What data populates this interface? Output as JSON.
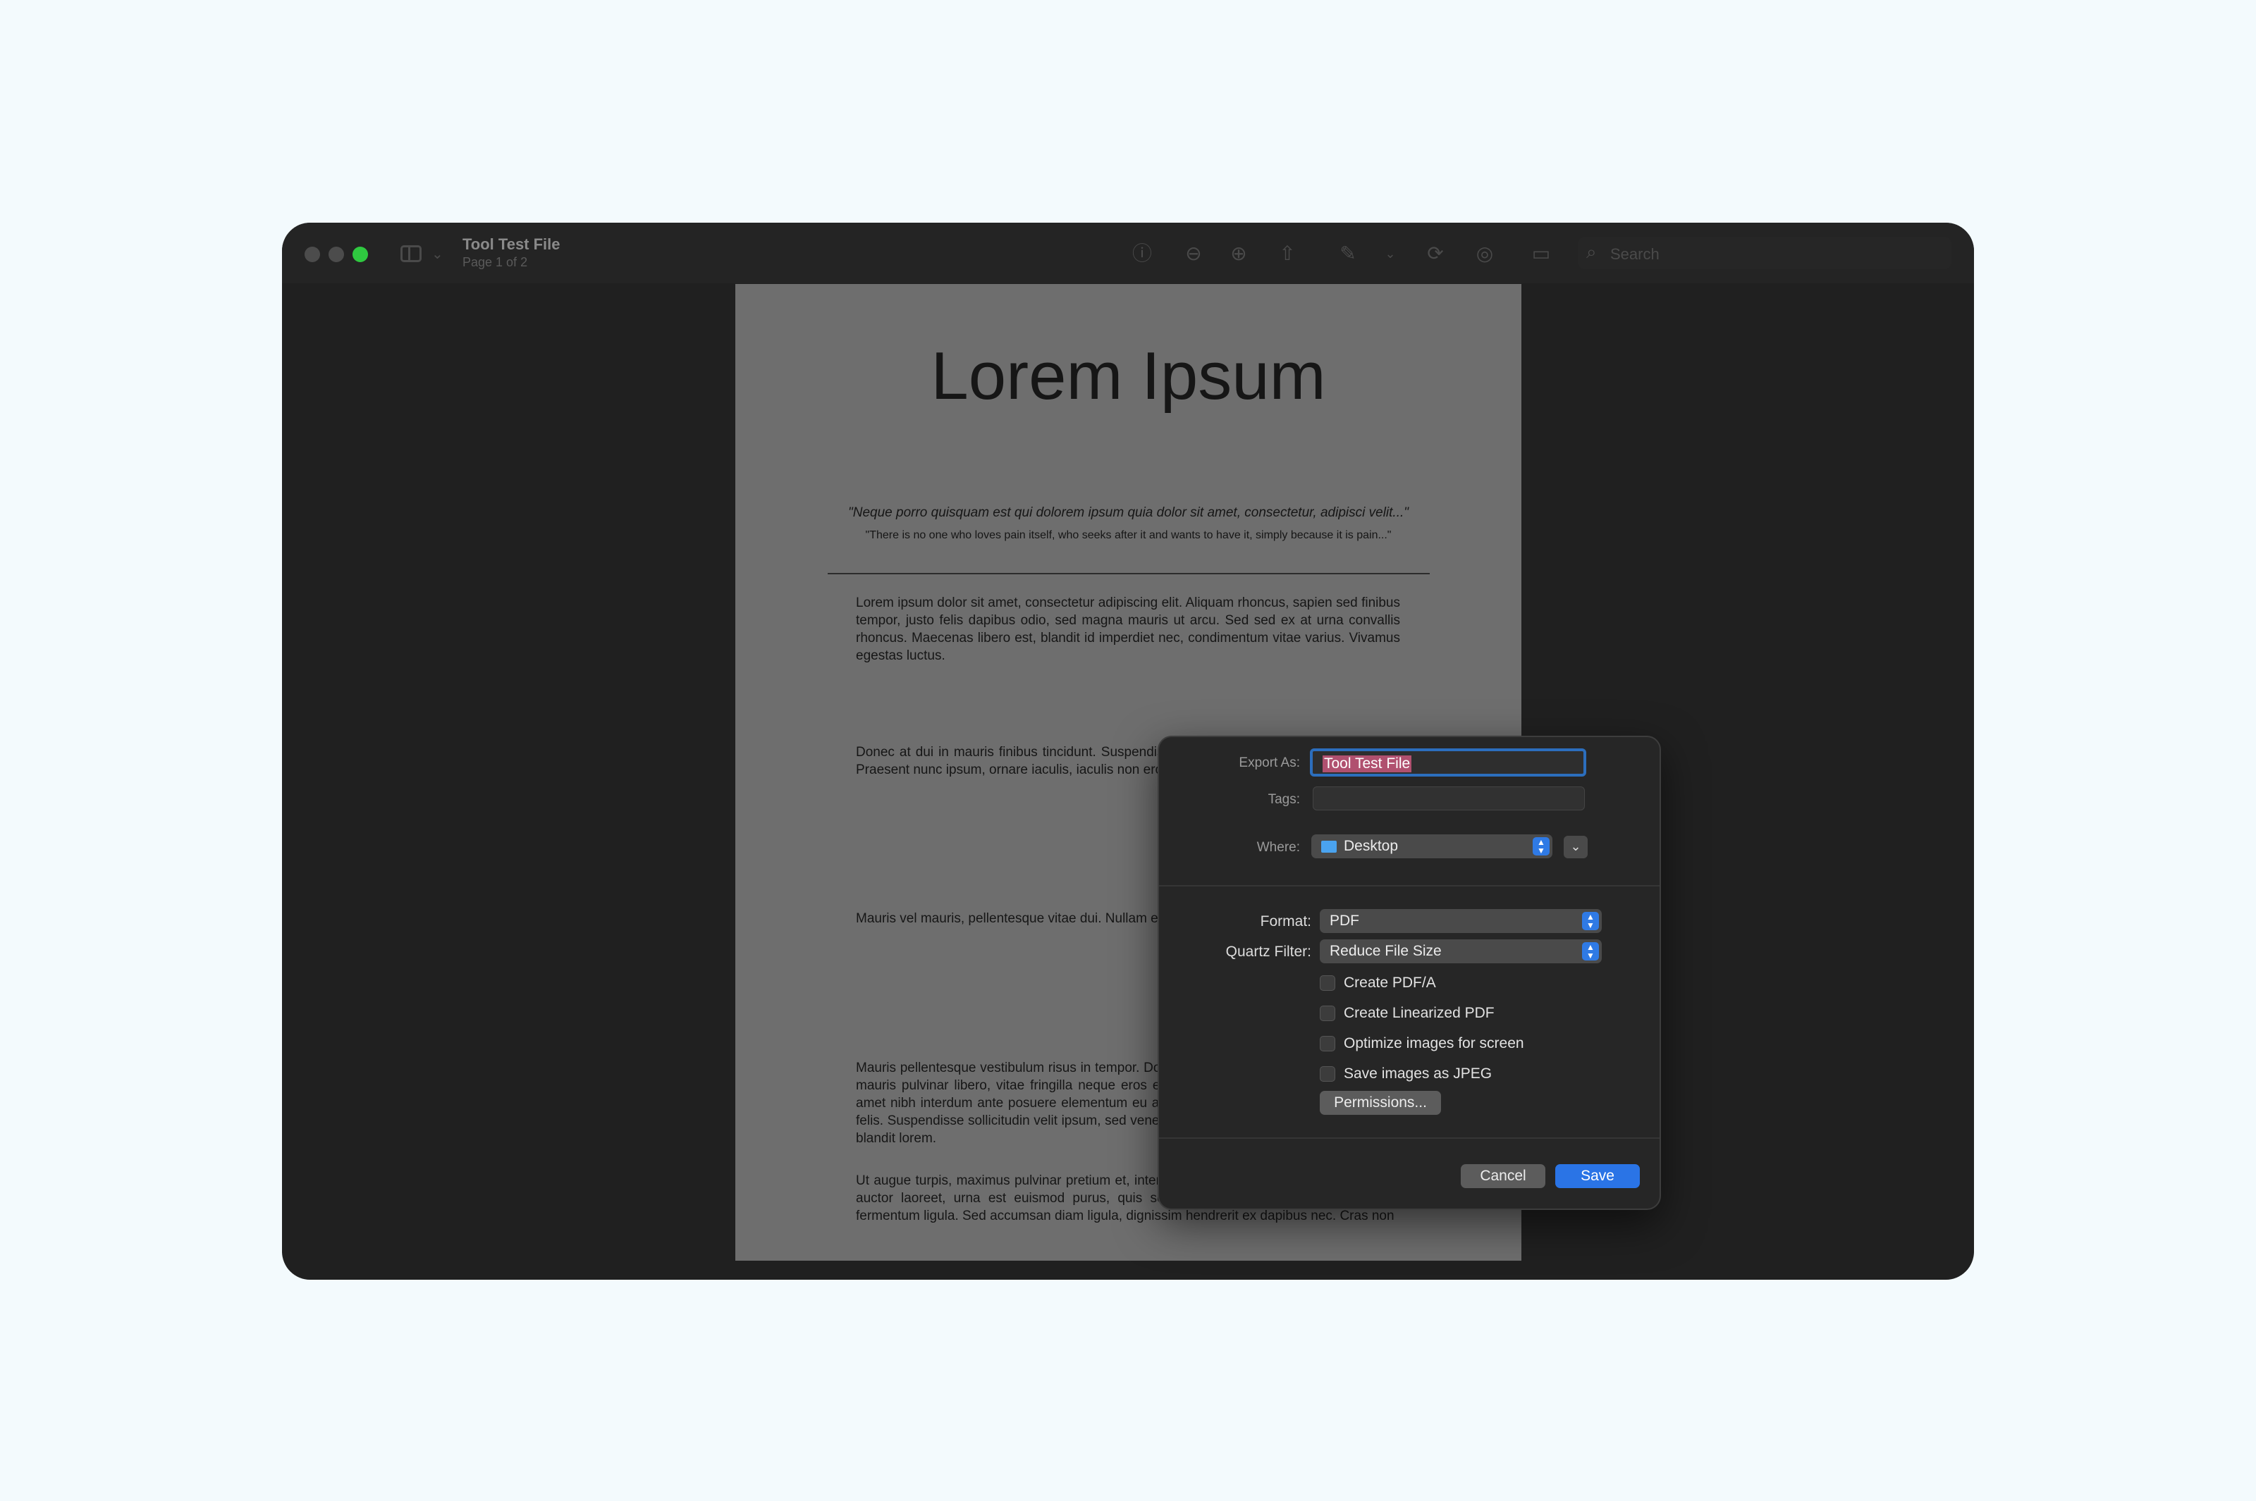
{
  "window": {
    "title": "Tool Test File",
    "subtitle": "Page 1 of 2",
    "search_placeholder": "Search"
  },
  "toolbar": {
    "icons": [
      "info-icon",
      "zoom-out-icon",
      "zoom-in-icon",
      "share-icon",
      "markup-icon",
      "rotate-icon",
      "annotate-icon",
      "form-icon"
    ]
  },
  "document": {
    "title": "Lorem Ipsum",
    "quote1": "\"Neque porro quisquam est qui dolorem ipsum quia dolor sit amet, consectetur, adipisci velit...\"",
    "quote2": "\"There is no one who loves pain itself, who seeks after it and wants to have it, simply because it is pain...\"",
    "paragraphs": [
      "Lorem ipsum dolor sit amet, consectetur adipiscing elit. Aliquam rhoncus, sapien sed finibus tempor, justo felis dapibus odio, sed magna mauris ut arcu. Sed sed ex at urna convallis rhoncus. Maecenas libero est, blandit id imperdiet nec, condimentum vitae varius. Vivamus egestas luctus.",
      "Donec at dui in mauris finibus tincidunt. Suspendisse erat curabitur lacus, sit amet ipsum. Praesent nunc ipsum, ornare iaculis, iaculis non eros, dapibus ac dui. Sed at ac.",
      "Mauris vel mauris, pellentesque vitae dui. Nullam et tortor at eu eros, sociis tristique.",
      "Mauris pellentesque vestibulum risus in tempor. Donec mollis, ligula in pulvinar auctor, urna mauris pulvinar libero, vitae fringilla neque eros et dui. Morbi nec pretium elit. Integer sit amet nibh interdum ante posuere elementum eu ac dui. Ut eu bibendum ligula, ac lobortis felis. Suspendisse sollicitudin velit ipsum, sed venenatis lectus dignissim vitae. Curabitur eu blandit lorem.",
      "Ut augue turpis, maximus pulvinar pretium et, interdum at est. Vestibulum cursus, elit vitae auctor laoreet, urna est euismod purus, quis sollicitudin eros justo id augue. Sed ut fermentum ligula. Sed accumsan diam ligula, dignissim hendrerit ex dapibus nec. Cras non"
    ]
  },
  "dialog": {
    "export_as_label": "Export As:",
    "export_as_value": "Tool Test File",
    "tags_label": "Tags:",
    "where_label": "Where:",
    "where_value": "Desktop",
    "format_label": "Format:",
    "format_value": "PDF",
    "quartz_label": "Quartz Filter:",
    "quartz_value": "Reduce File Size",
    "options": [
      {
        "label": "Create PDF/A",
        "checked": false
      },
      {
        "label": "Create Linearized PDF",
        "checked": false
      },
      {
        "label": "Optimize images for screen",
        "checked": false
      },
      {
        "label": "Save images as JPEG",
        "checked": false
      }
    ],
    "permissions_label": "Permissions...",
    "cancel_label": "Cancel",
    "save_label": "Save"
  }
}
